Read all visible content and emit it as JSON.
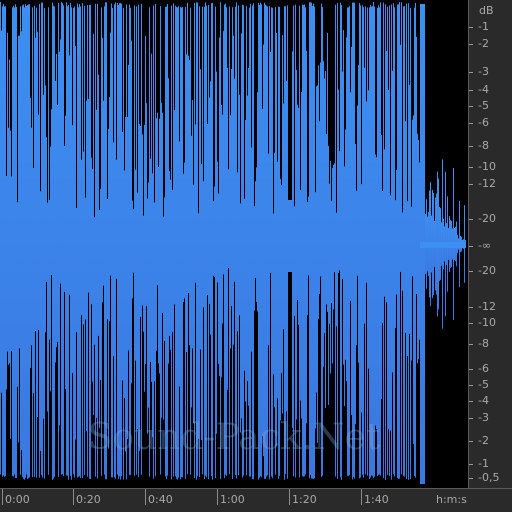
{
  "colors": {
    "waveform_top": "#3d8ff2",
    "waveform_bottom": "#3a78e0",
    "background": "#000000",
    "ruler_bg": "#2a2a2a",
    "ruler_text": "#a8a8a8"
  },
  "watermark": "Sound-Pack.Net",
  "db_ruler": {
    "unit": "dB",
    "labels": [
      "-1",
      "-2",
      "-3",
      "-4",
      "-5",
      "-6",
      "-8",
      "-10",
      "-12",
      "-20",
      "-∞",
      "-20",
      "-12",
      "-10",
      "-8",
      "-6",
      "-5",
      "-4",
      "-3",
      "-2",
      "-1",
      "-0,5"
    ]
  },
  "time_ruler": {
    "unit": "h:m:s",
    "labels": [
      "0:00",
      "0:20",
      "0:40",
      "1:00",
      "1:20",
      "1:40"
    ]
  }
}
